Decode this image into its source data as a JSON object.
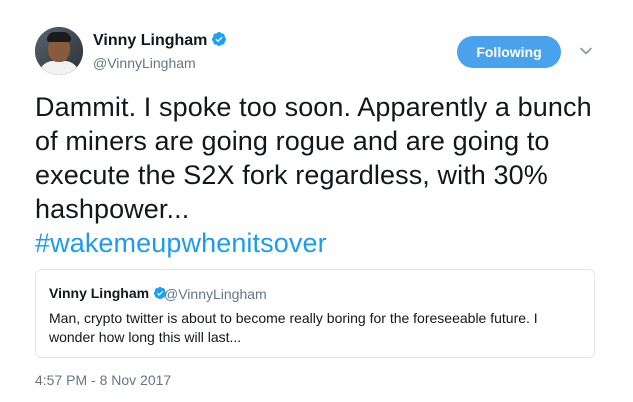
{
  "author": {
    "name": "Vinny Lingham",
    "handle": "@VinnyLingham",
    "verified": true
  },
  "follow_button": {
    "label": "Following"
  },
  "tweet": {
    "text": "Dammit. I spoke too soon. Apparently a bunch of miners are going rogue and are going to execute the S2X fork regardless, with 30% hashpower...",
    "hashtag": "#wakemeupwhenitsover",
    "timestamp": "4:57 PM - 8 Nov 2017"
  },
  "quoted_tweet": {
    "name": "Vinny Lingham",
    "handle": "@VinnyLingham",
    "verified": true,
    "text": "Man, crypto twitter is about to become really boring for the foreseeable future. I wonder how long this will last..."
  },
  "colors": {
    "accent": "#4aa1ec",
    "verified_badge": "#1da1f2",
    "hashtag": "#1d9bf0",
    "secondary_text": "#657786",
    "border": "#e1e8ed"
  },
  "icons": {
    "verified": "verified-badge-icon",
    "menu": "chevron-down-icon"
  }
}
